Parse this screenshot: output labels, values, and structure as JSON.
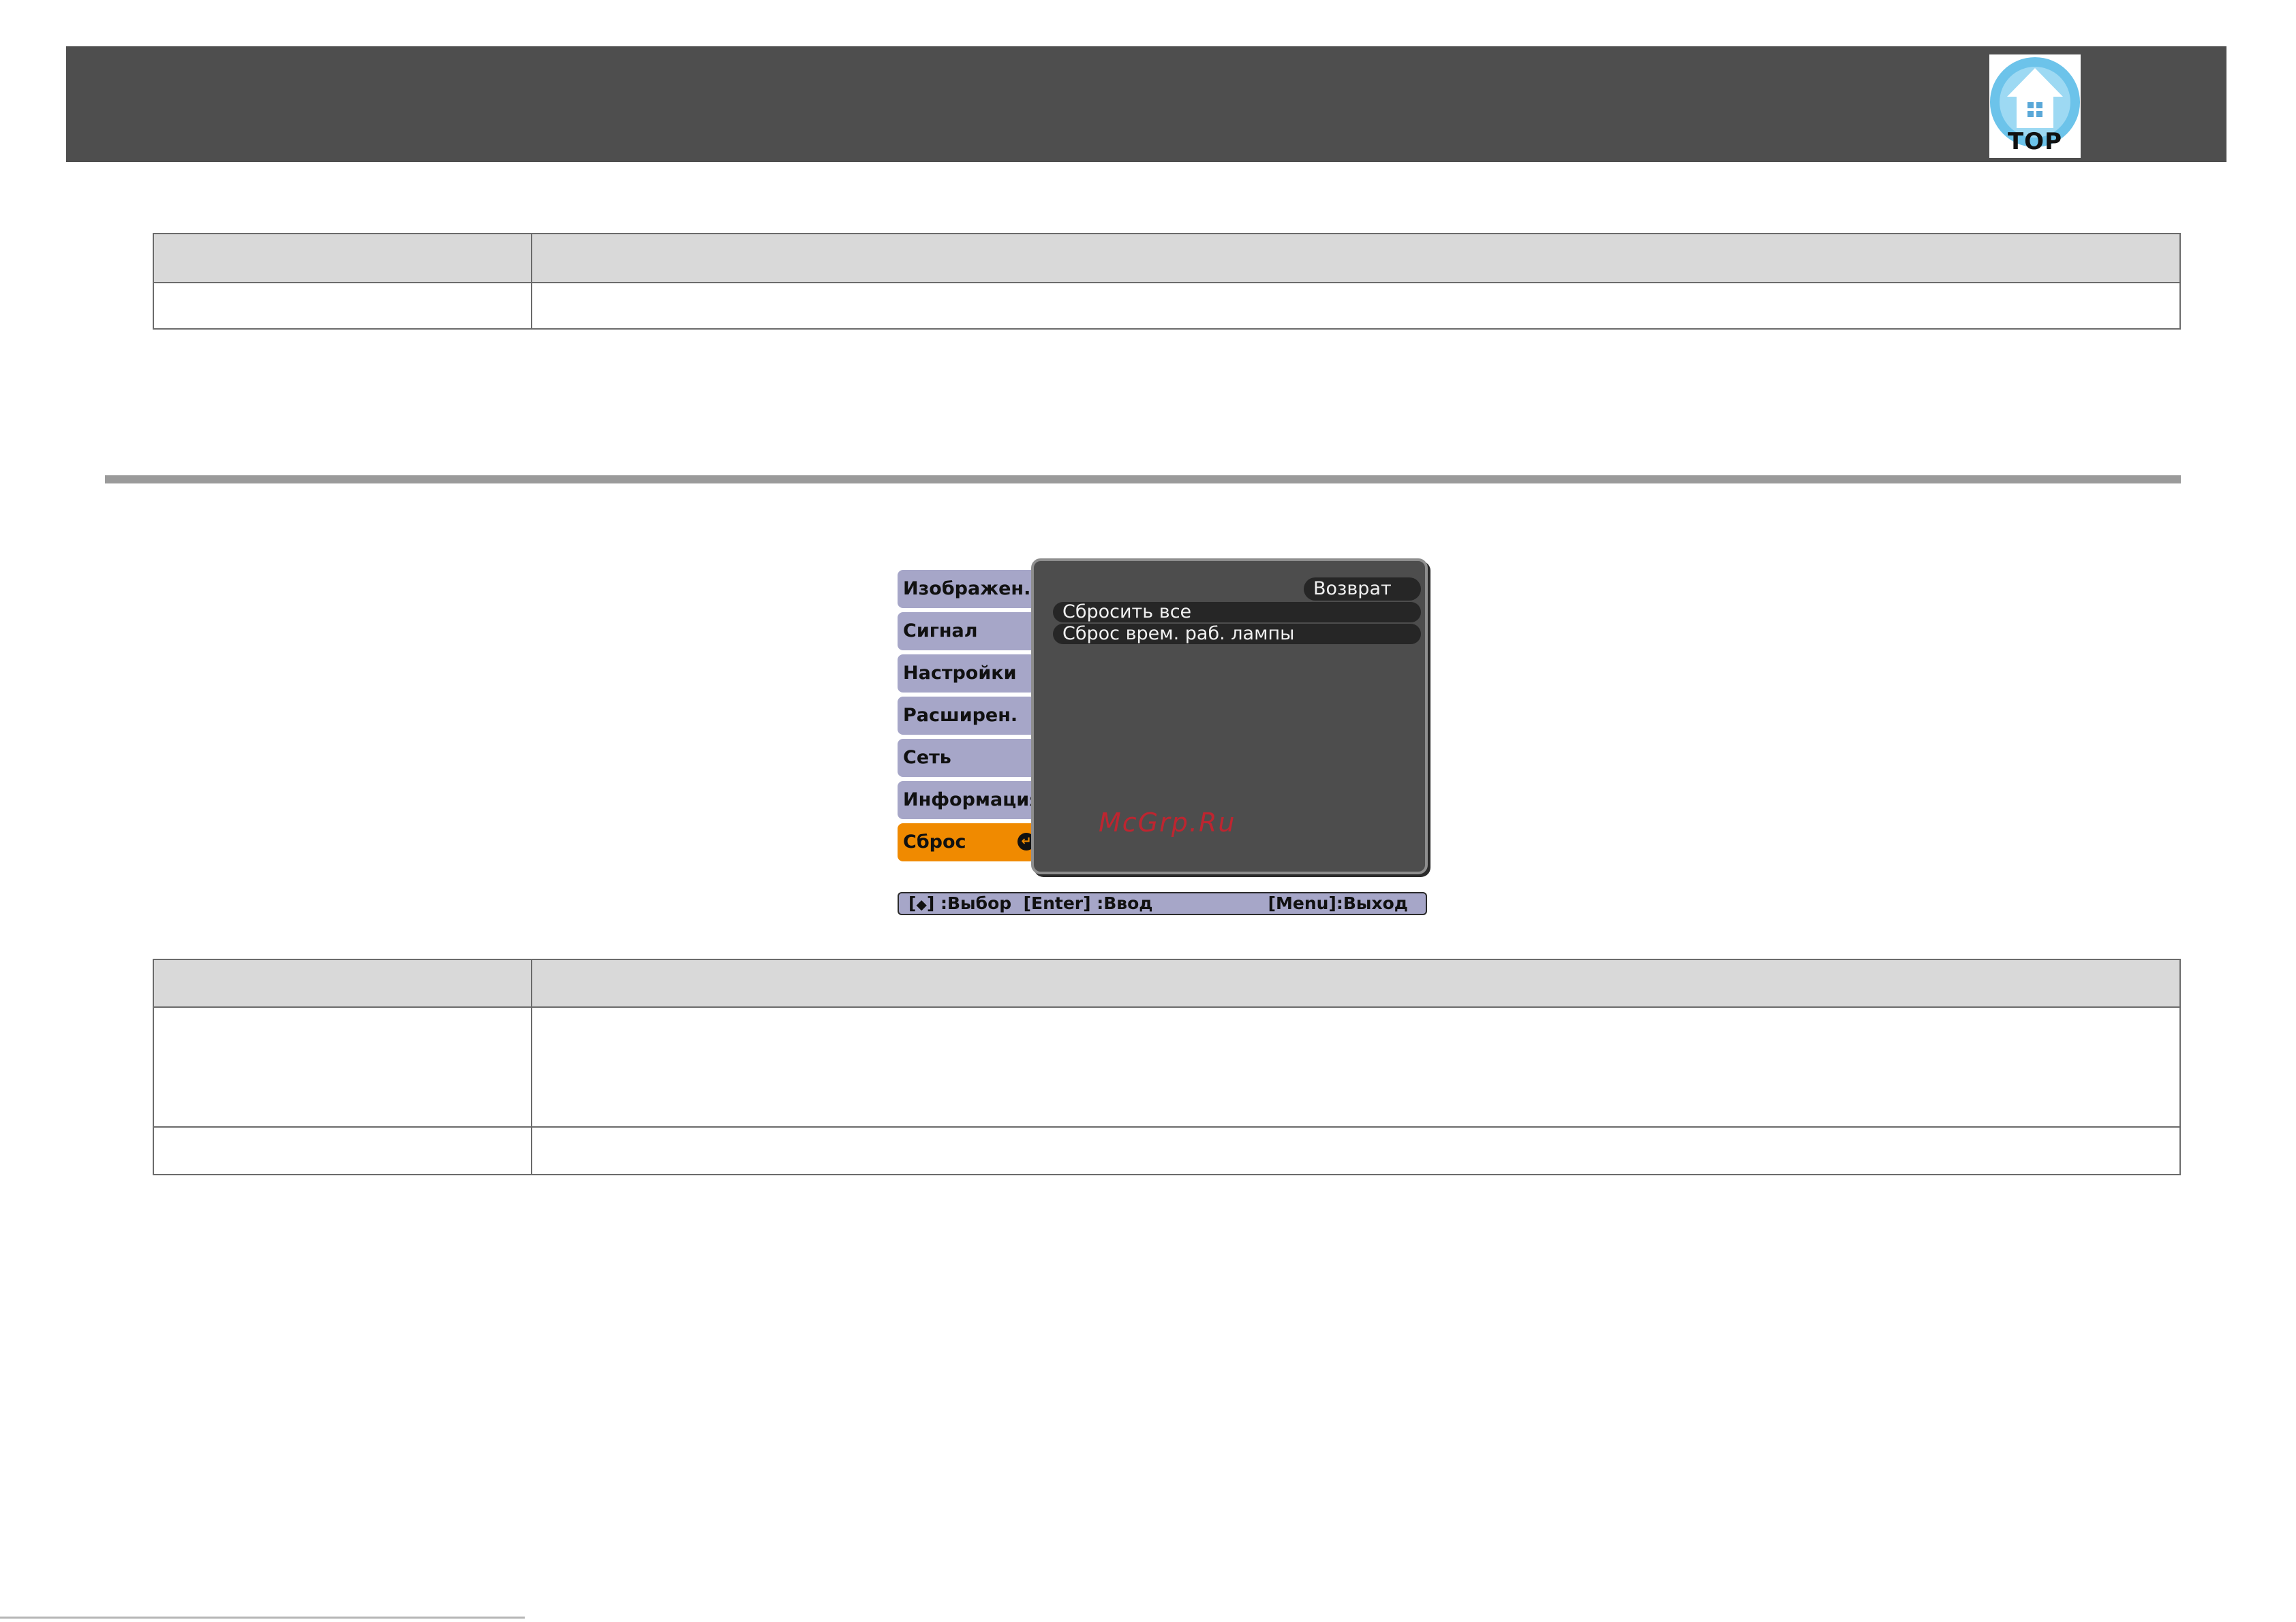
{
  "header": {
    "top_button_label": "TOP",
    "top_button_icon": "house-icon"
  },
  "osd_menu": {
    "tabs": [
      {
        "label": "Изображен.",
        "active": false
      },
      {
        "label": "Сигнал",
        "active": false
      },
      {
        "label": "Настройки",
        "active": false
      },
      {
        "label": "Расширен.",
        "active": false
      },
      {
        "label": "Сеть",
        "active": false
      },
      {
        "label": "Информация",
        "active": false
      },
      {
        "label": "Сброс",
        "active": true
      }
    ],
    "active_tab_icon": "enter-icon",
    "return_label": "Возврат",
    "items": [
      "Сбросить все",
      "Сброс врем. раб. лампы"
    ],
    "watermark": "McGrp.Ru",
    "help_bar": {
      "select_prefix": "[",
      "select_arrows": "◆",
      "select_suffix": "] :Выбор",
      "enter": "[Enter] :Ввод",
      "exit": "[Menu]:Выход"
    }
  },
  "colors": {
    "header_bar": "#4e4e4e",
    "table_header": "#d9d9d9",
    "tab_inactive": "#a6a6c8",
    "tab_active": "#f08a00",
    "osd_panel": "#4d4d4d",
    "watermark": "#d21f2b"
  }
}
